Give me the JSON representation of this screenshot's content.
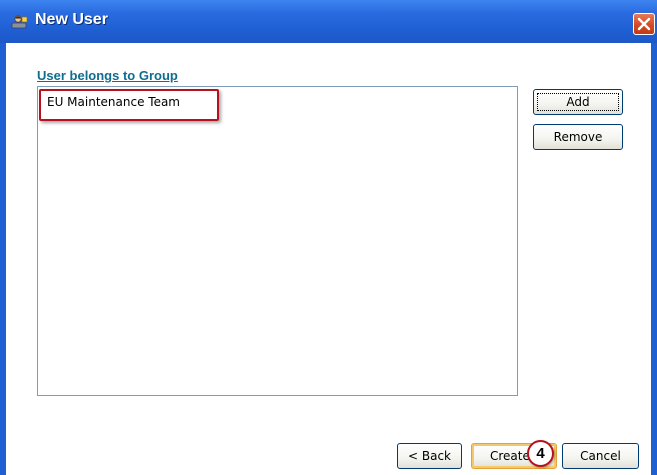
{
  "window": {
    "title": "New User",
    "icon": "new-user-icon",
    "close_icon": "close-icon"
  },
  "section": {
    "label": "User belongs to Group"
  },
  "group_list": {
    "items": [
      "EU Maintenance Team"
    ]
  },
  "side_buttons": {
    "add_label": "Add",
    "remove_label": "Remove"
  },
  "footer_buttons": {
    "back_label": "< Back",
    "create_label": "Create",
    "cancel_label": "Cancel"
  },
  "annotation": {
    "step_number": "4"
  },
  "colors": {
    "titlebar": "#1f5fd4",
    "label": "#0f6d8f",
    "highlight": "#b8101c",
    "close_button": "#d34a23"
  }
}
